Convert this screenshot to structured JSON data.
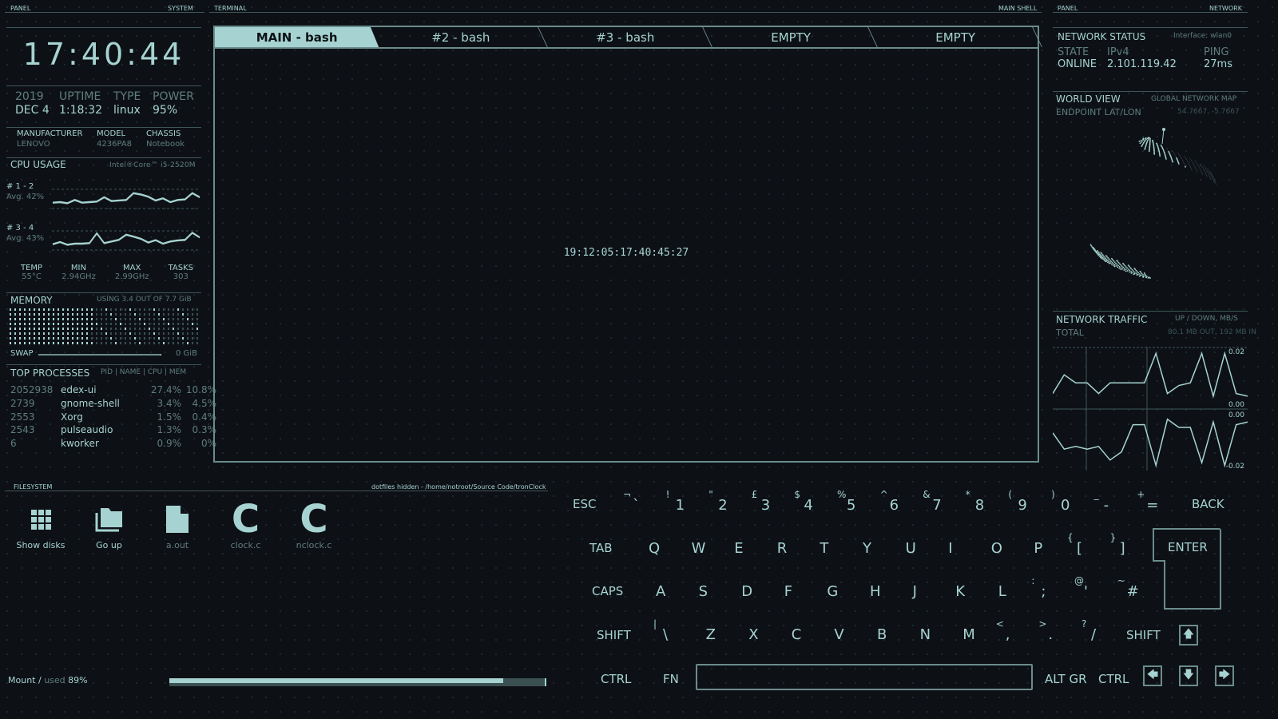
{
  "headers": {
    "left_panel": "PANEL",
    "left_system": "SYSTEM",
    "terminal": "TERMINAL",
    "main_shell": "MAIN SHELL",
    "right_panel": "PANEL",
    "right_network": "NETWORK",
    "filesystem": "FILESYSTEM",
    "fs_path": "dotfiles hidden - /home/notroot/Source Code/tronClock"
  },
  "clock": "17:40:44",
  "sysinfo": {
    "year": "2019",
    "date": "DEC 4",
    "uptime_label": "UPTIME",
    "uptime": "1:18:32",
    "type_label": "TYPE",
    "type": "linux",
    "power_label": "POWER",
    "power": "95%"
  },
  "hw": {
    "manufacturer_label": "MANUFACTURER",
    "manufacturer": "LENOVO",
    "model_label": "MODEL",
    "model": "4236PA8",
    "chassis_label": "CHASSIS",
    "chassis": "Notebook"
  },
  "cpu": {
    "title": "CPU USAGE",
    "model": "Intel®Core™ i5-2520M",
    "cores": [
      {
        "label": "# 1 - 2",
        "avg": "Avg. 42%",
        "values": [
          20,
          22,
          18,
          30,
          20,
          22,
          24,
          40,
          26,
          28,
          30,
          55,
          50,
          42,
          28,
          36,
          22,
          30,
          32,
          55,
          40
        ]
      },
      {
        "label": "# 3 - 4",
        "avg": "Avg. 43%",
        "values": [
          20,
          28,
          18,
          22,
          22,
          24,
          60,
          24,
          30,
          36,
          55,
          48,
          40,
          26,
          35,
          22,
          30,
          34,
          36,
          62,
          45
        ]
      }
    ],
    "temp_label": "TEMP",
    "temp": "55°C",
    "min_label": "MIN",
    "min": "2.94GHz",
    "max_label": "MAX",
    "max": "2.99GHz",
    "tasks_label": "TASKS",
    "tasks": "303"
  },
  "memory": {
    "title": "MEMORY",
    "usage": "USING 3.4 OUT OF 7.7 GiB",
    "swap_label": "SWAP",
    "swap": "0 GiB",
    "used_fraction": 0.44
  },
  "processes": {
    "title": "TOP PROCESSES",
    "columns": "PID | NAME | CPU | MEM",
    "rows": [
      {
        "pid": "2052938",
        "name": "edex-ui",
        "cpu": "27.4%",
        "mem": "10.8%"
      },
      {
        "pid": "2739",
        "name": "gnome-shell",
        "cpu": "3.4%",
        "mem": "4.5%"
      },
      {
        "pid": "2553",
        "name": "Xorg",
        "cpu": "1.5%",
        "mem": "0.4%"
      },
      {
        "pid": "2543",
        "name": "pulseaudio",
        "cpu": "1.3%",
        "mem": "0.3%"
      },
      {
        "pid": "6",
        "name": "kworker",
        "cpu": "0.9%",
        "mem": "0%"
      }
    ]
  },
  "terminal": {
    "tabs": [
      "MAIN - bash",
      "#2 - bash",
      "#3 - bash",
      "EMPTY",
      "EMPTY"
    ],
    "content": "19:12:05:17:40:45:27"
  },
  "network": {
    "title": "NETWORK STATUS",
    "interface": "Interface: wlan0",
    "state_label": "STATE",
    "state": "ONLINE",
    "ipv4_label": "IPv4",
    "ipv4": "2.101.119.42",
    "ping_label": "PING",
    "ping": "27ms"
  },
  "world": {
    "title": "WORLD VIEW",
    "subtitle": "GLOBAL NETWORK MAP",
    "endpoint_label": "ENDPOINT LAT/LON",
    "endpoint": "54.7667, -5.7667"
  },
  "traffic": {
    "title": "NETWORK TRAFFIC",
    "units": "UP / DOWN, MB/S",
    "total_label": "TOTAL",
    "total": "80.1 MB OUT, 192 MB IN",
    "up_max": "0.02",
    "up_min": "0.00",
    "down_max": "0.00",
    "down_min": "-0.02",
    "up": [
      0.004,
      0.011,
      0.008,
      0.008,
      0.004,
      0.008,
      0.008,
      0.008,
      0.008,
      0.019,
      0.004,
      0.007,
      0.008,
      0.019,
      0.003,
      0.019,
      0.004,
      0.003
    ],
    "down": [
      -0.007,
      -0.013,
      -0.012,
      -0.013,
      -0.012,
      -0.017,
      -0.014,
      -0.004,
      -0.004,
      -0.019,
      -0.002,
      -0.005,
      -0.005,
      -0.018,
      -0.003,
      -0.019,
      -0.004,
      -0.003
    ]
  },
  "filesystem": {
    "items": [
      {
        "label": "Show disks",
        "icon": "grid-icon"
      },
      {
        "label": "Go up",
        "icon": "folder-icon"
      },
      {
        "label": "a.out",
        "icon": "file-icon"
      },
      {
        "label": "clock.c",
        "icon": "c-file-icon"
      },
      {
        "label": "nclock.c",
        "icon": "c-file-icon"
      }
    ],
    "mount_label": "Mount",
    "used_label": "used",
    "used": "89%",
    "used_fraction": 0.89
  },
  "keyboard": {
    "row1": [
      [
        "`",
        "¬"
      ],
      [
        "1",
        "!"
      ],
      [
        "2",
        "\""
      ],
      [
        "3",
        "£"
      ],
      [
        "4",
        "$"
      ],
      [
        "5",
        "%"
      ],
      [
        "6",
        "^"
      ],
      [
        "7",
        "&"
      ],
      [
        "8",
        "*"
      ],
      [
        "9",
        "("
      ],
      [
        "0",
        ")"
      ],
      [
        "-",
        "_"
      ],
      [
        "=",
        "+"
      ]
    ],
    "row2": [
      [
        "Q",
        ""
      ],
      [
        "W",
        ""
      ],
      [
        "E",
        ""
      ],
      [
        "R",
        ""
      ],
      [
        "T",
        ""
      ],
      [
        "Y",
        ""
      ],
      [
        "U",
        ""
      ],
      [
        "I",
        ""
      ],
      [
        "O",
        ""
      ],
      [
        "P",
        ""
      ],
      [
        "[",
        "{"
      ],
      [
        "]",
        "}"
      ]
    ],
    "row3": [
      [
        "A",
        ""
      ],
      [
        "S",
        ""
      ],
      [
        "D",
        ""
      ],
      [
        "F",
        ""
      ],
      [
        "G",
        ""
      ],
      [
        "H",
        ""
      ],
      [
        "J",
        ""
      ],
      [
        "K",
        ""
      ],
      [
        "L",
        ""
      ],
      [
        ";",
        ":"
      ],
      [
        "'",
        "@"
      ],
      [
        "#",
        "~"
      ]
    ],
    "row4": [
      [
        "\\",
        "|"
      ],
      [
        "Z",
        ""
      ],
      [
        "X",
        ""
      ],
      [
        "C",
        ""
      ],
      [
        "V",
        ""
      ],
      [
        "B",
        ""
      ],
      [
        "N",
        ""
      ],
      [
        "M",
        ""
      ],
      [
        ",",
        "<"
      ],
      [
        ".",
        ">"
      ],
      [
        "/",
        "?"
      ]
    ],
    "esc": "ESC",
    "back": "BACK",
    "tab": "TAB",
    "enter": "ENTER",
    "caps": "CAPS",
    "shift": "SHIFT",
    "ctrl": "CTRL",
    "fn": "FN",
    "altgr": "ALT GR",
    "arrows": {
      "up": "🡅",
      "down": "🡇",
      "left": "🡄",
      "right": "🡆"
    }
  }
}
